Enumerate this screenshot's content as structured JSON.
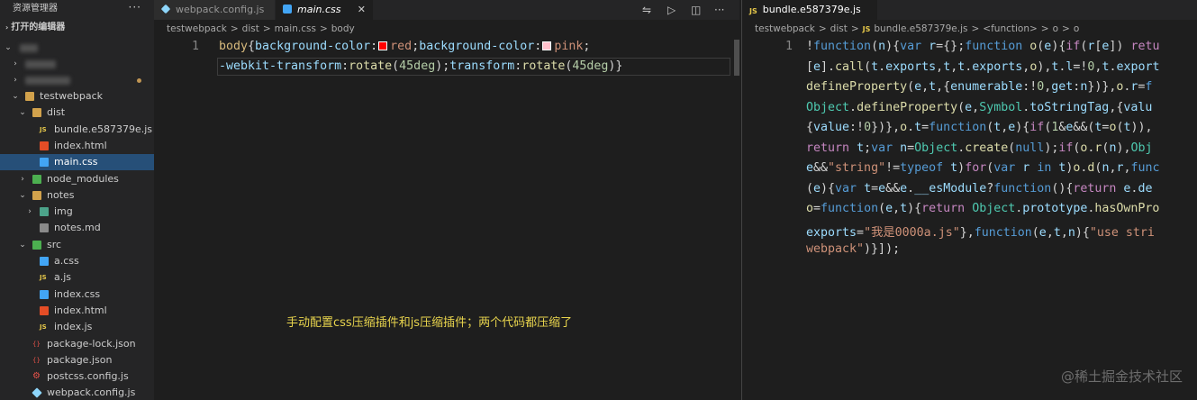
{
  "sidebar": {
    "title": "资源管理器",
    "more": "···",
    "open_editors": "打开的编辑器",
    "tree": [
      {
        "label": "testwebpack",
        "type": "folder",
        "depth": 1,
        "open": true
      },
      {
        "label": "dist",
        "type": "folder",
        "depth": 2,
        "open": true
      },
      {
        "label": "bundle.e587379e.js",
        "type": "js",
        "depth": 3
      },
      {
        "label": "index.html",
        "type": "html",
        "depth": 3
      },
      {
        "label": "main.css",
        "type": "css",
        "depth": 3,
        "selected": true
      },
      {
        "label": "node_modules",
        "type": "folder-green",
        "depth": 2,
        "open": false
      },
      {
        "label": "notes",
        "type": "folder",
        "depth": 2,
        "open": true
      },
      {
        "label": "img",
        "type": "folder-img",
        "depth": 3,
        "open": false
      },
      {
        "label": "notes.md",
        "type": "md",
        "depth": 3
      },
      {
        "label": "src",
        "type": "folder-green",
        "depth": 2,
        "open": true
      },
      {
        "label": "a.css",
        "type": "css",
        "depth": 3
      },
      {
        "label": "a.js",
        "type": "js",
        "depth": 3
      },
      {
        "label": "index.css",
        "type": "css",
        "depth": 3
      },
      {
        "label": "index.html",
        "type": "html",
        "depth": 3
      },
      {
        "label": "index.js",
        "type": "js",
        "depth": 3
      },
      {
        "label": "package-lock.json",
        "type": "json",
        "depth": 2
      },
      {
        "label": "package.json",
        "type": "json",
        "depth": 2
      },
      {
        "label": "postcss.config.js",
        "type": "gear",
        "depth": 2
      },
      {
        "label": "webpack.config.js",
        "type": "wp",
        "depth": 2
      }
    ]
  },
  "editor1": {
    "tabs": [
      {
        "label": "webpack.config.js",
        "active": false
      },
      {
        "label": "main.css",
        "active": true
      }
    ],
    "breadcrumb": [
      "testwebpack",
      ">",
      "dist",
      ">",
      "main.css",
      ">",
      "body"
    ],
    "line_number": "1",
    "code_line1": [
      {
        "t": "body",
        "c": "sel"
      },
      {
        "t": "{",
        "c": "punc"
      },
      {
        "t": "background-color",
        "c": "prop"
      },
      {
        "t": ":",
        "c": "punc"
      },
      {
        "swatch": "#ff0000"
      },
      {
        "t": "red",
        "c": "val"
      },
      {
        "t": ";",
        "c": "punc"
      },
      {
        "t": "background-color",
        "c": "prop"
      },
      {
        "t": ":",
        "c": "punc"
      },
      {
        "swatch": "#ffc0cb"
      },
      {
        "t": "pink",
        "c": "val"
      },
      {
        "t": ";",
        "c": "punc"
      }
    ],
    "code_line2": [
      {
        "t": "-webkit-transform",
        "c": "prop"
      },
      {
        "t": ":",
        "c": "punc"
      },
      {
        "t": "rotate",
        "c": "fn"
      },
      {
        "t": "(",
        "c": "punc"
      },
      {
        "t": "45deg",
        "c": "num"
      },
      {
        "t": ")",
        "c": "punc"
      },
      {
        "t": ";",
        "c": "punc"
      },
      {
        "t": "transform",
        "c": "prop"
      },
      {
        "t": ":",
        "c": "punc"
      },
      {
        "t": "rotate",
        "c": "fn"
      },
      {
        "t": "(",
        "c": "punc"
      },
      {
        "t": "45deg",
        "c": "num"
      },
      {
        "t": ")",
        "c": "punc"
      },
      {
        "t": "}",
        "c": "punc"
      }
    ],
    "note": "手动配置css压缩插件和js压缩插件；两个代码都压缩了"
  },
  "editor2": {
    "tab": "bundle.e587379e.js",
    "breadcrumb": [
      "testwebpack",
      ">",
      "dist",
      ">",
      "JS",
      "bundle.e587379e.js",
      ">",
      "<function>",
      ">",
      "o",
      ">",
      "o"
    ],
    "line_number": "1",
    "lines": [
      [
        {
          "t": "!",
          "c": "punc"
        },
        {
          "t": "function",
          "c": "kw"
        },
        {
          "t": "(",
          "c": "punc"
        },
        {
          "t": "n",
          "c": "var"
        },
        {
          "t": "){",
          "c": "punc"
        },
        {
          "t": "var",
          "c": "kw"
        },
        {
          "t": " ",
          "c": "punc"
        },
        {
          "t": "r",
          "c": "var"
        },
        {
          "t": "={};",
          "c": "punc"
        },
        {
          "t": "function",
          "c": "kw"
        },
        {
          "t": " ",
          "c": "punc"
        },
        {
          "t": "o",
          "c": "fn"
        },
        {
          "t": "(",
          "c": "punc"
        },
        {
          "t": "e",
          "c": "var"
        },
        {
          "t": "){",
          "c": "punc"
        },
        {
          "t": "if",
          "c": "kw2"
        },
        {
          "t": "(",
          "c": "punc"
        },
        {
          "t": "r",
          "c": "var"
        },
        {
          "t": "[",
          "c": "punc"
        },
        {
          "t": "e",
          "c": "var"
        },
        {
          "t": "]) ",
          "c": "punc"
        },
        {
          "t": "retu",
          "c": "kw2"
        }
      ],
      [
        {
          "t": "[",
          "c": "punc"
        },
        {
          "t": "e",
          "c": "var"
        },
        {
          "t": "].",
          "c": "punc"
        },
        {
          "t": "call",
          "c": "fn"
        },
        {
          "t": "(",
          "c": "punc"
        },
        {
          "t": "t",
          "c": "var"
        },
        {
          "t": ".",
          "c": "punc"
        },
        {
          "t": "exports",
          "c": "var"
        },
        {
          "t": ",",
          "c": "punc"
        },
        {
          "t": "t",
          "c": "var"
        },
        {
          "t": ",",
          "c": "punc"
        },
        {
          "t": "t",
          "c": "var"
        },
        {
          "t": ".",
          "c": "punc"
        },
        {
          "t": "exports",
          "c": "var"
        },
        {
          "t": ",",
          "c": "punc"
        },
        {
          "t": "o",
          "c": "fn"
        },
        {
          "t": "),",
          "c": "punc"
        },
        {
          "t": "t",
          "c": "var"
        },
        {
          "t": ".",
          "c": "punc"
        },
        {
          "t": "l",
          "c": "var"
        },
        {
          "t": "=!",
          "c": "punc"
        },
        {
          "t": "0",
          "c": "num"
        },
        {
          "t": ",",
          "c": "punc"
        },
        {
          "t": "t",
          "c": "var"
        },
        {
          "t": ".",
          "c": "punc"
        },
        {
          "t": "export",
          "c": "var"
        }
      ],
      [
        {
          "t": "defineProperty",
          "c": "fn"
        },
        {
          "t": "(",
          "c": "punc"
        },
        {
          "t": "e",
          "c": "var"
        },
        {
          "t": ",",
          "c": "punc"
        },
        {
          "t": "t",
          "c": "var"
        },
        {
          "t": ",{",
          "c": "punc"
        },
        {
          "t": "enumerable",
          "c": "var"
        },
        {
          "t": ":!",
          "c": "punc"
        },
        {
          "t": "0",
          "c": "num"
        },
        {
          "t": ",",
          "c": "punc"
        },
        {
          "t": "get",
          "c": "var"
        },
        {
          "t": ":",
          "c": "punc"
        },
        {
          "t": "n",
          "c": "var"
        },
        {
          "t": "})},",
          "c": "punc"
        },
        {
          "t": "o",
          "c": "fn"
        },
        {
          "t": ".",
          "c": "punc"
        },
        {
          "t": "r",
          "c": "var"
        },
        {
          "t": "=",
          "c": "punc"
        },
        {
          "t": "f",
          "c": "kw"
        }
      ],
      [
        {
          "t": "Object",
          "c": "cls"
        },
        {
          "t": ".",
          "c": "punc"
        },
        {
          "t": "defineProperty",
          "c": "fn"
        },
        {
          "t": "(",
          "c": "punc"
        },
        {
          "t": "e",
          "c": "var"
        },
        {
          "t": ",",
          "c": "punc"
        },
        {
          "t": "Symbol",
          "c": "cls"
        },
        {
          "t": ".",
          "c": "punc"
        },
        {
          "t": "toStringTag",
          "c": "var"
        },
        {
          "t": ",{",
          "c": "punc"
        },
        {
          "t": "valu",
          "c": "var"
        }
      ],
      [
        {
          "t": "{",
          "c": "punc"
        },
        {
          "t": "value",
          "c": "var"
        },
        {
          "t": ":!",
          "c": "punc"
        },
        {
          "t": "0",
          "c": "num"
        },
        {
          "t": "})},",
          "c": "punc"
        },
        {
          "t": "o",
          "c": "fn"
        },
        {
          "t": ".",
          "c": "punc"
        },
        {
          "t": "t",
          "c": "var"
        },
        {
          "t": "=",
          "c": "punc"
        },
        {
          "t": "function",
          "c": "kw"
        },
        {
          "t": "(",
          "c": "punc"
        },
        {
          "t": "t",
          "c": "var"
        },
        {
          "t": ",",
          "c": "punc"
        },
        {
          "t": "e",
          "c": "var"
        },
        {
          "t": "){",
          "c": "punc"
        },
        {
          "t": "if",
          "c": "kw2"
        },
        {
          "t": "(",
          "c": "punc"
        },
        {
          "t": "1",
          "c": "num"
        },
        {
          "t": "&",
          "c": "punc"
        },
        {
          "t": "e",
          "c": "var"
        },
        {
          "t": "&&(",
          "c": "punc"
        },
        {
          "t": "t",
          "c": "var"
        },
        {
          "t": "=",
          "c": "punc"
        },
        {
          "t": "o",
          "c": "fn"
        },
        {
          "t": "(",
          "c": "punc"
        },
        {
          "t": "t",
          "c": "var"
        },
        {
          "t": ")),",
          "c": "punc"
        }
      ],
      [
        {
          "t": "return",
          "c": "kw2"
        },
        {
          "t": " ",
          "c": "punc"
        },
        {
          "t": "t",
          "c": "var"
        },
        {
          "t": ";",
          "c": "punc"
        },
        {
          "t": "var",
          "c": "kw"
        },
        {
          "t": " ",
          "c": "punc"
        },
        {
          "t": "n",
          "c": "var"
        },
        {
          "t": "=",
          "c": "punc"
        },
        {
          "t": "Object",
          "c": "cls"
        },
        {
          "t": ".",
          "c": "punc"
        },
        {
          "t": "create",
          "c": "fn"
        },
        {
          "t": "(",
          "c": "punc"
        },
        {
          "t": "null",
          "c": "kw"
        },
        {
          "t": ");",
          "c": "punc"
        },
        {
          "t": "if",
          "c": "kw2"
        },
        {
          "t": "(",
          "c": "punc"
        },
        {
          "t": "o",
          "c": "fn"
        },
        {
          "t": ".",
          "c": "punc"
        },
        {
          "t": "r",
          "c": "fn"
        },
        {
          "t": "(",
          "c": "punc"
        },
        {
          "t": "n",
          "c": "var"
        },
        {
          "t": "),",
          "c": "punc"
        },
        {
          "t": "Obj",
          "c": "cls"
        }
      ],
      [
        {
          "t": "e",
          "c": "var"
        },
        {
          "t": "&&",
          "c": "punc"
        },
        {
          "t": "\"string\"",
          "c": "str"
        },
        {
          "t": "!=",
          "c": "punc"
        },
        {
          "t": "typeof",
          "c": "kw"
        },
        {
          "t": " ",
          "c": "punc"
        },
        {
          "t": "t",
          "c": "var"
        },
        {
          "t": ")",
          "c": "punc"
        },
        {
          "t": "for",
          "c": "kw2"
        },
        {
          "t": "(",
          "c": "punc"
        },
        {
          "t": "var",
          "c": "kw"
        },
        {
          "t": " ",
          "c": "punc"
        },
        {
          "t": "r",
          "c": "var"
        },
        {
          "t": " ",
          "c": "punc"
        },
        {
          "t": "in",
          "c": "kw"
        },
        {
          "t": " ",
          "c": "punc"
        },
        {
          "t": "t",
          "c": "var"
        },
        {
          "t": ")",
          "c": "punc"
        },
        {
          "t": "o",
          "c": "fn"
        },
        {
          "t": ".",
          "c": "punc"
        },
        {
          "t": "d",
          "c": "fn"
        },
        {
          "t": "(",
          "c": "punc"
        },
        {
          "t": "n",
          "c": "var"
        },
        {
          "t": ",",
          "c": "punc"
        },
        {
          "t": "r",
          "c": "var"
        },
        {
          "t": ",",
          "c": "punc"
        },
        {
          "t": "func",
          "c": "kw"
        }
      ],
      [
        {
          "t": "(",
          "c": "punc"
        },
        {
          "t": "e",
          "c": "var"
        },
        {
          "t": "){",
          "c": "punc"
        },
        {
          "t": "var",
          "c": "kw"
        },
        {
          "t": " ",
          "c": "punc"
        },
        {
          "t": "t",
          "c": "var"
        },
        {
          "t": "=",
          "c": "punc"
        },
        {
          "t": "e",
          "c": "var"
        },
        {
          "t": "&&",
          "c": "punc"
        },
        {
          "t": "e",
          "c": "var"
        },
        {
          "t": ".",
          "c": "punc"
        },
        {
          "t": "__esModule",
          "c": "var"
        },
        {
          "t": "?",
          "c": "punc"
        },
        {
          "t": "function",
          "c": "kw"
        },
        {
          "t": "(){",
          "c": "punc"
        },
        {
          "t": "return",
          "c": "kw2"
        },
        {
          "t": " ",
          "c": "punc"
        },
        {
          "t": "e",
          "c": "var"
        },
        {
          "t": ".",
          "c": "punc"
        },
        {
          "t": "de",
          "c": "var"
        }
      ],
      [
        {
          "t": "o",
          "c": "fn"
        },
        {
          "t": "=",
          "c": "punc"
        },
        {
          "t": "function",
          "c": "kw"
        },
        {
          "t": "(",
          "c": "punc"
        },
        {
          "t": "e",
          "c": "var"
        },
        {
          "t": ",",
          "c": "punc"
        },
        {
          "t": "t",
          "c": "var"
        },
        {
          "t": "){",
          "c": "punc"
        },
        {
          "t": "return",
          "c": "kw2"
        },
        {
          "t": " ",
          "c": "punc"
        },
        {
          "t": "Object",
          "c": "cls"
        },
        {
          "t": ".",
          "c": "punc"
        },
        {
          "t": "prototype",
          "c": "var"
        },
        {
          "t": ".",
          "c": "punc"
        },
        {
          "t": "hasOwnPro",
          "c": "fn"
        }
      ],
      [
        {
          "t": "exports",
          "c": "var"
        },
        {
          "t": "=",
          "c": "punc"
        },
        {
          "t": "\"我是0000a.js\"",
          "c": "str"
        },
        {
          "t": "},",
          "c": "punc"
        },
        {
          "t": "function",
          "c": "kw"
        },
        {
          "t": "(",
          "c": "punc"
        },
        {
          "t": "e",
          "c": "var"
        },
        {
          "t": ",",
          "c": "punc"
        },
        {
          "t": "t",
          "c": "var"
        },
        {
          "t": ",",
          "c": "punc"
        },
        {
          "t": "n",
          "c": "var"
        },
        {
          "t": "){",
          "c": "punc"
        },
        {
          "t": "\"use stri",
          "c": "str"
        }
      ],
      [
        {
          "t": "webpack\"",
          "c": "str"
        },
        {
          "t": ")}]);",
          "c": "punc"
        }
      ]
    ]
  },
  "watermark": "@稀土掘金技术社区",
  "colors": {
    "accent": "#264f78",
    "background": "#1e1e1e",
    "sidebar": "#252526",
    "note": "#e8d44d"
  }
}
